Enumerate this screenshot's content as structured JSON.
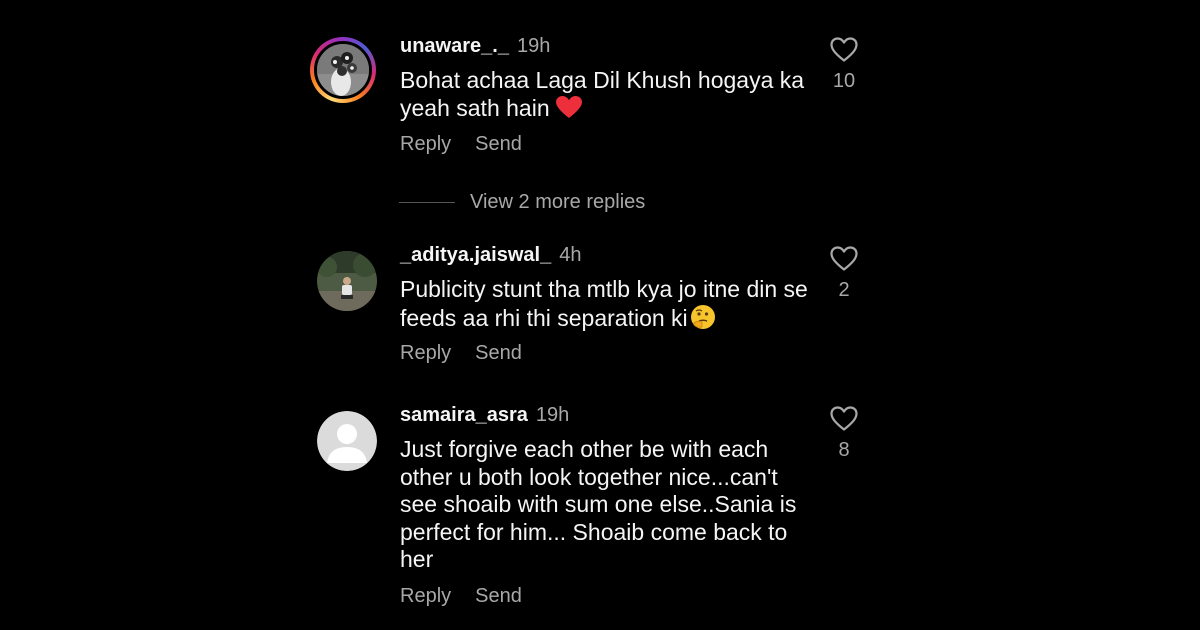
{
  "comments": [
    {
      "username": "unaware_._",
      "time": "19h",
      "text": "Bohat achaa Laga Dil Khush hogaya ka yeah sath hain",
      "emoji": "❤️",
      "reply_label": "Reply",
      "send_label": "Send",
      "likes": "10"
    },
    {
      "username": "_aditya.jaiswal_",
      "time": "4h",
      "text": "Publicity stunt tha mtlb kya jo itne din se feeds aa rhi thi separation ki",
      "emoji": "🤔",
      "reply_label": "Reply",
      "send_label": "Send",
      "likes": "2"
    },
    {
      "username": "samaira_asra",
      "time": "19h",
      "text": "Just forgive each other be with each other u both look together nice...can't see shoaib with sum one else..Sania is perfect for him... Shoaib come back to her",
      "reply_label": "Reply",
      "send_label": "Send",
      "likes": "8"
    }
  ],
  "view_more_replies": "View 2 more replies",
  "colors": {
    "background": "#000000",
    "primary_text": "#f5f5f5",
    "secondary_text": "#a8a8a8",
    "heart_red": "#ed2f3b"
  },
  "icons": {
    "like": "heart-outline-icon",
    "reaction_1": "red-heart-emoji",
    "reaction_2": "thinking-face-emoji"
  }
}
